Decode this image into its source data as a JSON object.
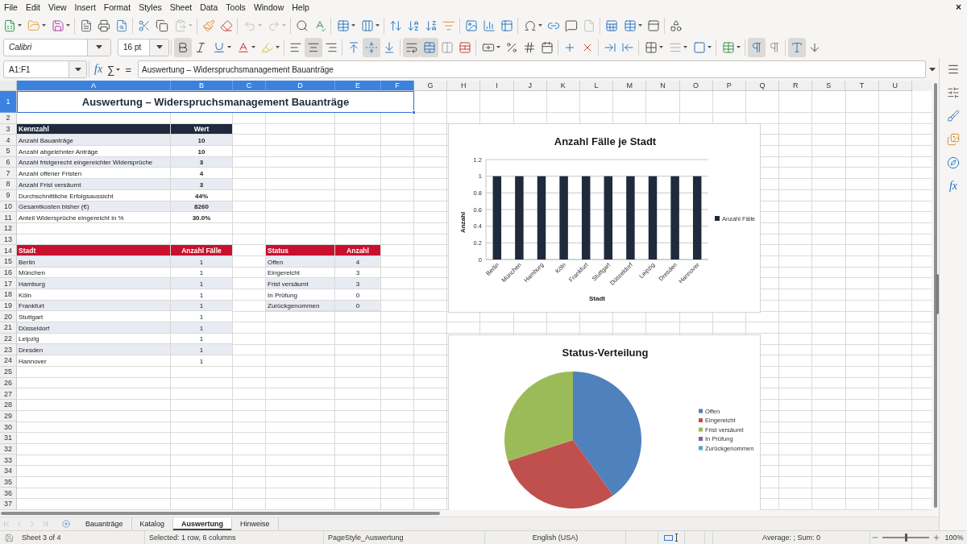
{
  "menu": [
    "File",
    "Edit",
    "View",
    "Insert",
    "Format",
    "Styles",
    "Sheet",
    "Data",
    "Tools",
    "Window",
    "Help"
  ],
  "close_document_glyph": "×",
  "standard_toolbar": {
    "groups": [
      [
        {
          "kind": "new",
          "dropdown": true,
          "disabled": false
        },
        {
          "kind": "open",
          "dropdown": true,
          "disabled": false
        },
        {
          "kind": "save",
          "dropdown": true,
          "disabled": false
        }
      ],
      [
        {
          "kind": "export_pdf",
          "dropdown": false,
          "disabled": false
        },
        {
          "kind": "print",
          "dropdown": false,
          "disabled": false
        },
        {
          "kind": "print_preview",
          "dropdown": false,
          "disabled": false
        }
      ],
      [
        {
          "kind": "cut",
          "dropdown": false,
          "disabled": false
        },
        {
          "kind": "copy",
          "dropdown": false,
          "disabled": false
        },
        {
          "kind": "paste",
          "dropdown": true,
          "disabled": true
        }
      ],
      [
        {
          "kind": "clone_formatting",
          "dropdown": false,
          "disabled": false
        },
        {
          "kind": "clear_formatting",
          "dropdown": false,
          "disabled": false
        }
      ],
      [
        {
          "kind": "undo",
          "dropdown": true,
          "disabled": true
        },
        {
          "kind": "redo",
          "dropdown": true,
          "disabled": true
        }
      ],
      [
        {
          "kind": "find_replace",
          "dropdown": false,
          "disabled": false
        },
        {
          "kind": "spelling",
          "dropdown": false,
          "disabled": false
        }
      ],
      [
        {
          "kind": "rows",
          "dropdown": true,
          "disabled": false
        },
        {
          "kind": "columns",
          "dropdown": true,
          "disabled": false
        }
      ],
      [
        {
          "kind": "sort",
          "dropdown": false,
          "disabled": false
        },
        {
          "kind": "sort_ascending",
          "dropdown": false,
          "disabled": false
        },
        {
          "kind": "sort_descending",
          "dropdown": false,
          "disabled": false
        },
        {
          "kind": "autofilter",
          "dropdown": false,
          "disabled": false
        }
      ],
      [
        {
          "kind": "image",
          "dropdown": false,
          "disabled": false
        },
        {
          "kind": "chart",
          "dropdown": false,
          "disabled": false
        },
        {
          "kind": "pivot_table",
          "dropdown": false,
          "disabled": false
        }
      ],
      [
        {
          "kind": "special_character",
          "dropdown": true,
          "disabled": false
        },
        {
          "kind": "hyperlink",
          "dropdown": false,
          "disabled": false
        },
        {
          "kind": "comment",
          "dropdown": false,
          "disabled": false
        },
        {
          "kind": "header_footer",
          "dropdown": false,
          "disabled": true
        }
      ],
      [
        {
          "kind": "print_area",
          "dropdown": false,
          "disabled": false
        },
        {
          "kind": "freeze",
          "dropdown": true,
          "disabled": false
        },
        {
          "kind": "split_window",
          "dropdown": false,
          "disabled": false
        }
      ],
      [
        {
          "kind": "shapes",
          "dropdown": false,
          "disabled": false
        }
      ]
    ]
  },
  "formatting_toolbar": {
    "font_name": "Calibri",
    "font_size": "16 pt",
    "groups": [
      [
        {
          "kind": "bold",
          "pressed": true,
          "dropdown": false
        },
        {
          "kind": "italic",
          "pressed": false,
          "dropdown": false
        },
        {
          "kind": "underline",
          "pressed": false,
          "dropdown": true
        },
        {
          "kind": "font_color",
          "pressed": false,
          "dropdown": true
        },
        {
          "kind": "highlight",
          "pressed": false,
          "dropdown": true
        }
      ],
      [
        {
          "kind": "align_left",
          "pressed": false,
          "dropdown": false
        },
        {
          "kind": "align_center",
          "pressed": true,
          "dropdown": false
        },
        {
          "kind": "align_right",
          "pressed": false,
          "dropdown": false
        }
      ],
      [
        {
          "kind": "align_top",
          "pressed": false,
          "dropdown": false
        },
        {
          "kind": "align_middle",
          "pressed": true,
          "dropdown": false
        },
        {
          "kind": "align_bottom",
          "pressed": false,
          "dropdown": false
        }
      ],
      [
        {
          "kind": "wrap_text",
          "pressed": true,
          "dropdown": false
        },
        {
          "kind": "merge_center",
          "pressed": true,
          "dropdown": false
        },
        {
          "kind": "merge_cells",
          "pressed": false,
          "dropdown": false
        },
        {
          "kind": "unmerge_cells",
          "pressed": false,
          "dropdown": false
        }
      ],
      [
        {
          "kind": "currency",
          "pressed": false,
          "dropdown": true
        },
        {
          "kind": "percent",
          "pressed": false,
          "dropdown": false
        },
        {
          "kind": "number",
          "pressed": false,
          "dropdown": false
        },
        {
          "kind": "date",
          "pressed": false,
          "dropdown": false
        }
      ],
      [
        {
          "kind": "add_decimal",
          "pressed": false,
          "dropdown": false
        },
        {
          "kind": "delete_decimal",
          "pressed": false,
          "dropdown": false
        }
      ],
      [
        {
          "kind": "indent_increase",
          "pressed": false,
          "dropdown": false
        },
        {
          "kind": "indent_decrease",
          "pressed": false,
          "dropdown": false
        }
      ],
      [
        {
          "kind": "borders",
          "pressed": false,
          "dropdown": true
        },
        {
          "kind": "border_style",
          "pressed": false,
          "dropdown": true
        },
        {
          "kind": "border_color",
          "pressed": false,
          "dropdown": true
        }
      ],
      [
        {
          "kind": "conditional",
          "pressed": false,
          "dropdown": true
        }
      ],
      [
        {
          "kind": "left_to_right",
          "pressed": true,
          "dropdown": false
        },
        {
          "kind": "right_to_left",
          "pressed": false,
          "dropdown": false
        }
      ],
      [
        {
          "kind": "text_horizontal",
          "pressed": true,
          "dropdown": false
        },
        {
          "kind": "text_vertical",
          "pressed": false,
          "dropdown": false
        }
      ]
    ]
  },
  "formula_bar": {
    "name_box": "A1:F1",
    "function_glyph": "fx",
    "sum_glyph": "∑",
    "equals_glyph": "=",
    "content": "Auswertung – Widerspruchsmanagement Bauanträge"
  },
  "sidebar": {
    "functions_glyph": "fx"
  },
  "sheet": {
    "columns": [
      {
        "label": "A",
        "selected": true
      },
      {
        "label": "B",
        "selected": true
      },
      {
        "label": "C",
        "selected": true
      },
      {
        "label": "D",
        "selected": true
      },
      {
        "label": "E",
        "selected": true
      },
      {
        "label": "F",
        "selected": true
      },
      {
        "label": "G",
        "selected": false
      },
      {
        "label": "H",
        "selected": false
      },
      {
        "label": "I",
        "selected": false
      },
      {
        "label": "J",
        "selected": false
      },
      {
        "label": "K",
        "selected": false
      },
      {
        "label": "L",
        "selected": false
      },
      {
        "label": "M",
        "selected": false
      },
      {
        "label": "N",
        "selected": false
      },
      {
        "label": "O",
        "selected": false
      },
      {
        "label": "P",
        "selected": false
      },
      {
        "label": "Q",
        "selected": false
      },
      {
        "label": "R",
        "selected": false
      },
      {
        "label": "S",
        "selected": false
      },
      {
        "label": "T",
        "selected": false
      },
      {
        "label": "U",
        "selected": false
      }
    ],
    "rows": [
      {
        "label": "1",
        "selected": true
      },
      {
        "label": "2",
        "selected": false
      },
      {
        "label": "3",
        "selected": false
      },
      {
        "label": "4",
        "selected": false
      },
      {
        "label": "5",
        "selected": false
      },
      {
        "label": "6",
        "selected": false
      },
      {
        "label": "7",
        "selected": false
      },
      {
        "label": "8",
        "selected": false
      },
      {
        "label": "9",
        "selected": false
      },
      {
        "label": "10",
        "selected": false
      },
      {
        "label": "11",
        "selected": false
      },
      {
        "label": "12",
        "selected": false
      },
      {
        "label": "13",
        "selected": false
      },
      {
        "label": "14",
        "selected": false
      },
      {
        "label": "15",
        "selected": false
      },
      {
        "label": "16",
        "selected": false
      },
      {
        "label": "17",
        "selected": false
      },
      {
        "label": "18",
        "selected": false
      },
      {
        "label": "19",
        "selected": false
      },
      {
        "label": "20",
        "selected": false
      },
      {
        "label": "21",
        "selected": false
      },
      {
        "label": "22",
        "selected": false
      },
      {
        "label": "23",
        "selected": false
      },
      {
        "label": "24",
        "selected": false
      },
      {
        "label": "25",
        "selected": false
      },
      {
        "label": "26",
        "selected": false
      },
      {
        "label": "27",
        "selected": false
      },
      {
        "label": "28",
        "selected": false
      },
      {
        "label": "29",
        "selected": false
      },
      {
        "label": "30",
        "selected": false
      },
      {
        "label": "31",
        "selected": false
      },
      {
        "label": "32",
        "selected": false
      },
      {
        "label": "33",
        "selected": false
      },
      {
        "label": "34",
        "selected": false
      },
      {
        "label": "35",
        "selected": false
      },
      {
        "label": "36",
        "selected": false
      },
      {
        "label": "37",
        "selected": false
      }
    ],
    "title": {
      "text": "Auswertung – Widerspruchsmanagement Bauanträge",
      "selected": true
    },
    "kpi_table": {
      "columns": [
        "Kennzahl",
        "Wert"
      ],
      "rows": [
        [
          "Anzahl Bauanträge",
          "10"
        ],
        [
          "Anzahl abgelehnter Anträge",
          "10"
        ],
        [
          "Anzahl fristgerecht eingereichter Widersprüche",
          "3"
        ],
        [
          "Anzahl offener Fristen",
          "4"
        ],
        [
          "Anzahl Frist versäumt",
          "3"
        ],
        [
          "Durchschnittliche Erfolgsaussicht",
          "44%"
        ],
        [
          "Gesamtkosten bisher (€)",
          "8260"
        ],
        [
          "Anteil Widersprüche eingereicht in %",
          "30.0%"
        ]
      ]
    },
    "city_table": {
      "columns": [
        "Stadt",
        "Anzahl Fälle"
      ],
      "rows": [
        [
          "Berlin",
          "1"
        ],
        [
          "München",
          "1"
        ],
        [
          "Hamburg",
          "1"
        ],
        [
          "Köln",
          "1"
        ],
        [
          "Frankfurt",
          "1"
        ],
        [
          "Stuttgart",
          "1"
        ],
        [
          "Düsseldorf",
          "1"
        ],
        [
          "Leipzig",
          "1"
        ],
        [
          "Dresden",
          "1"
        ],
        [
          "Hannover",
          "1"
        ]
      ]
    },
    "status_table": {
      "columns": [
        "Status",
        "Anzahl"
      ],
      "rows": [
        [
          "Offen",
          "4"
        ],
        [
          "Eingereicht",
          "3"
        ],
        [
          "Frist versäumt",
          "3"
        ],
        [
          "In Prüfung",
          "0"
        ],
        [
          "Zurückgenommen",
          "0"
        ]
      ]
    },
    "charts": [
      {
        "chart_data": {
          "type": "bar",
          "title": "Anzahl Fälle je Stadt",
          "xlabel": "Stadt",
          "ylabel": "Anzahl",
          "categories": [
            "Berlin",
            "München",
            "Hamburg",
            "Köln",
            "Frankfurt",
            "Stuttgart",
            "Düsseldorf",
            "Leipzig",
            "Dresden",
            "Hannover"
          ],
          "series": [
            {
              "name": "Anzahl Fälle",
              "color": "#1f2a3c",
              "values": [
                1,
                1,
                1,
                1,
                1,
                1,
                1,
                1,
                1,
                1
              ]
            }
          ],
          "ylim": [
            0,
            1.2
          ],
          "yticks": [
            {
              "value": 0,
              "label": "0"
            },
            {
              "value": 0.2,
              "label": "0.2"
            },
            {
              "value": 0.4,
              "label": "0.4"
            },
            {
              "value": 0.6,
              "label": "0.6"
            },
            {
              "value": 0.8,
              "label": "0.8"
            },
            {
              "value": 1,
              "label": "1"
            },
            {
              "value": 1.2,
              "label": "1.2"
            }
          ],
          "grid": true,
          "legend": "right"
        }
      },
      {
        "chart_data": {
          "type": "pie",
          "title": "Status-Verteilung",
          "categories": [
            "Offen",
            "Eingereicht",
            "Frist versäumt",
            "In Prüfung",
            "Zurückgenommen"
          ],
          "values": [
            40,
            30,
            30,
            0,
            0
          ],
          "legend": "right"
        }
      }
    ]
  },
  "sheet_tabs": [
    {
      "label": "Bauanträge",
      "selected": false
    },
    {
      "label": "Katalog",
      "selected": false
    },
    {
      "label": "Auswertung",
      "selected": true
    },
    {
      "label": "Hinweise",
      "selected": false
    }
  ],
  "status_bar": {
    "sheet": "Sheet 3 of 4",
    "selection": "Selected: 1 row, 6 columns",
    "page_style": "PageStyle_Auswertung",
    "language": "English (USA)",
    "summary": "Average: ; Sum: 0",
    "zoom_slider": {
      "level": 0.5
    },
    "zoom": "100%"
  }
}
